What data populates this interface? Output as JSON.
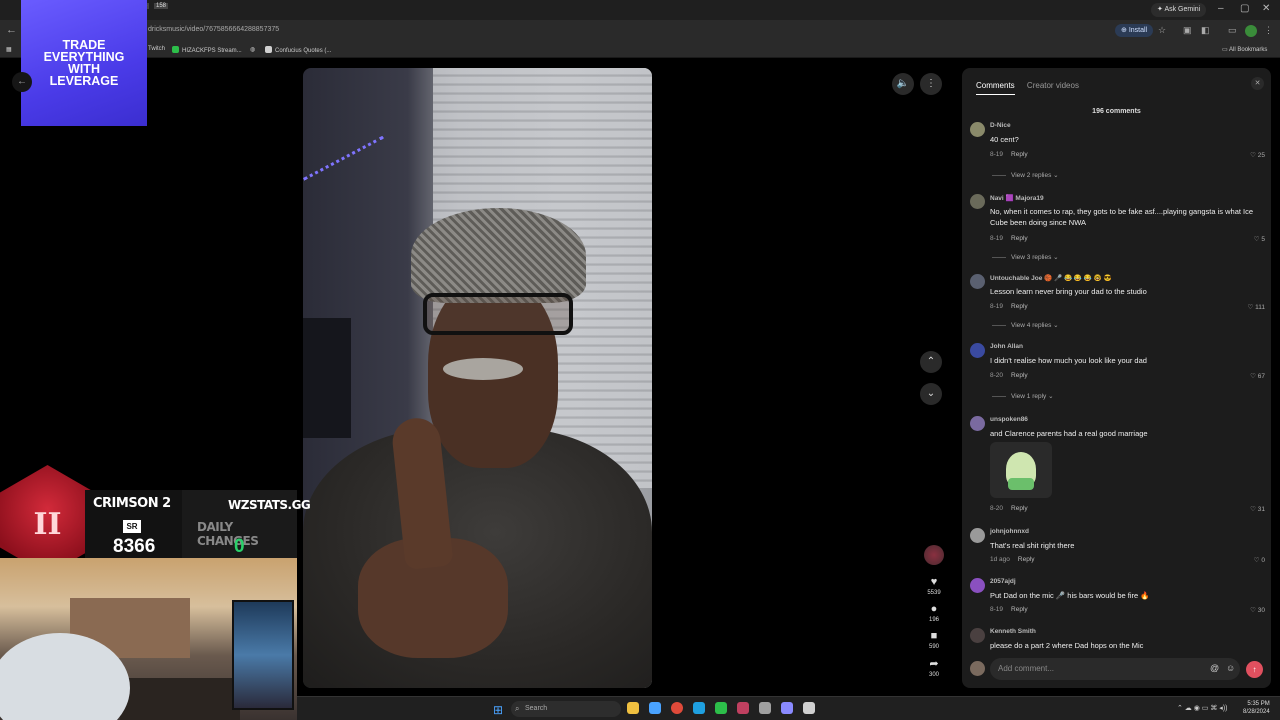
{
  "browser": {
    "tab_counts": [
      "5",
      "158"
    ],
    "window_controls": [
      "–",
      "▢",
      "✕"
    ],
    "ask_gemini": "Ask Gemini",
    "url": "dricksmusic/video/7675856664288857375",
    "install": "Install",
    "bookmarks": [
      {
        "label": "Twitch",
        "color": "#9146ff"
      },
      {
        "label": "HIZACKFPS Stream...",
        "color": "#2dbe4a"
      },
      {
        "label": "",
        "color": "#888888"
      },
      {
        "label": "Confucius Quotes (...",
        "color": "#d0d0d0"
      }
    ],
    "all_bookmarks": "All Bookmarks"
  },
  "ad": {
    "text": "TRADE EVERYTHING WITH LEVERAGE",
    "color": "#5a4cf0"
  },
  "video": {
    "actions": [
      {
        "icon": "heart-icon",
        "glyph": "♥",
        "count": "5539"
      },
      {
        "icon": "comment-icon",
        "glyph": "●",
        "count": "196"
      },
      {
        "icon": "bookmark-icon",
        "glyph": "■",
        "count": "590"
      },
      {
        "icon": "share-icon",
        "glyph": "➦",
        "count": "300"
      }
    ]
  },
  "comments_panel": {
    "tabs": [
      "Comments",
      "Creator videos"
    ],
    "count_label": "196 comments",
    "comments": [
      {
        "name": "D-Nice",
        "text": "40 cent?",
        "date": "8-19",
        "reply": "Reply",
        "likes": "25",
        "view_replies": "View 2 replies",
        "avatar_color": "#8a8a6a"
      },
      {
        "name": "Navi 🟪 Majora19",
        "text": "No, when it comes to rap, they gots to be fake asf....playing gangsta is what Ice Cube been doing since NWA",
        "date": "8-19",
        "reply": "Reply",
        "likes": "5",
        "view_replies": "View 3 replies",
        "avatar_color": "#6a6a5a"
      },
      {
        "name": "Untouchable Joe 🏀 🎤 😂 😂 😂 🤓 😎",
        "text": "Lesson learn never bring your dad to the studio",
        "date": "8-19",
        "reply": "Reply",
        "likes": "111",
        "view_replies": "View 4 replies",
        "avatar_color": "#5a6070"
      },
      {
        "name": "John Allan",
        "text": "I didn't realise how much you look like your dad",
        "date": "8-20",
        "reply": "Reply",
        "likes": "67",
        "view_replies": "View 1 reply",
        "avatar_color": "#3a4aa0"
      },
      {
        "name": "unspoken86",
        "text": "and Clarence parents had a real good marriage",
        "date": "8-20",
        "reply": "Reply",
        "likes": "31",
        "view_replies": "",
        "avatar_color": "#7a6aa0"
      },
      {
        "name": "johnjohnnxd",
        "text": "That's real shit right there",
        "date": "1d ago",
        "reply": "Reply",
        "likes": "0",
        "view_replies": "",
        "avatar_color": "#9a9a9a"
      },
      {
        "name": "2057ajdj",
        "text": "Put Dad on the mic 🎤 his bars would be fire 🔥",
        "date": "8-19",
        "reply": "Reply",
        "likes": "30",
        "view_replies": "",
        "avatar_color": "#8a50c0"
      },
      {
        "name": "Kenneth Smith",
        "text": "please do a part 2 where Dad hops on the Mic",
        "date": "",
        "reply": "",
        "likes": "",
        "view_replies": "",
        "avatar_color": "#4a4040"
      }
    ],
    "input_placeholder": "Add comment..."
  },
  "stream_overlay": {
    "emblem": "II",
    "rank_label": "CRIMSON 2",
    "sr_label": "SR",
    "sr_value": "8366",
    "site": "WZSTATS.GG",
    "daily_label": "DAILY CHANGES",
    "daily_value": "0"
  },
  "taskbar": {
    "search": "Search",
    "time": "5:35 PM",
    "date": "8/28/2024",
    "apps": [
      "#4aa3ff",
      "#f0c040",
      "#e04a3a",
      "#2dbe4a",
      "#1fa0e0",
      "#3a9a3a",
      "#c04060",
      "#8a8aff",
      "#a0a0a0",
      "#d0d0d0"
    ]
  }
}
